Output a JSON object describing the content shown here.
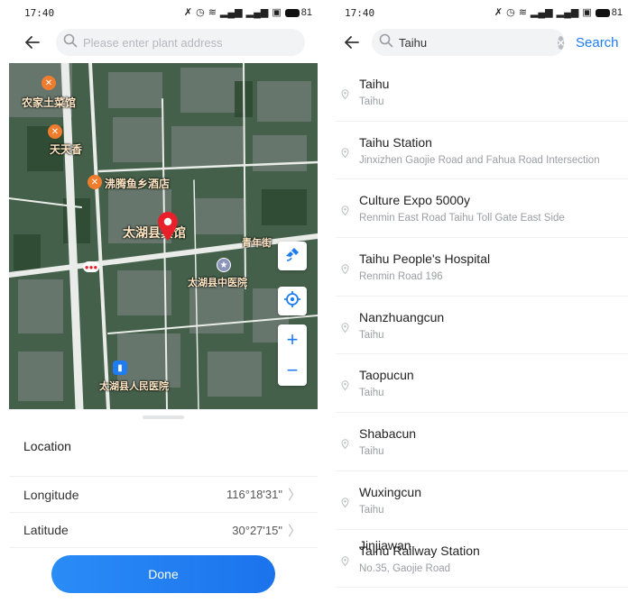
{
  "left": {
    "status": {
      "time": "17:40",
      "battery": "81"
    },
    "search": {
      "placeholder": "Please enter plant address",
      "value": ""
    },
    "map": {
      "labels": [
        "农家土菜馆",
        "天天香",
        "沸腾鱼乡酒店",
        "太湖县宾馆",
        "青年街",
        "太湖县中医院",
        "太湖县人民医院"
      ]
    },
    "sheet": {
      "title": "Location",
      "longitude_label": "Longitude",
      "longitude_value": "116°18'31\"",
      "latitude_label": "Latitude",
      "latitude_value": "30°27'15\"",
      "done_label": "Done"
    }
  },
  "right": {
    "status": {
      "time": "17:40",
      "battery": "81"
    },
    "search": {
      "value": "Taihu",
      "action_label": "Search"
    },
    "results": [
      {
        "name": "Taihu",
        "address": "Taihu"
      },
      {
        "name": "Taihu Station",
        "address": "Jinxizhen Gaojie Road and Fahua Road Intersection"
      },
      {
        "name": "Culture Expo 5000y",
        "address": "Renmin East Road Taihu Toll Gate East Side"
      },
      {
        "name": "Taihu People's Hospital",
        "address": "Renmin Road 196"
      },
      {
        "name": "Nanzhuangcun",
        "address": "Taihu"
      },
      {
        "name": "Taopucun",
        "address": "Taihu"
      },
      {
        "name": "Shabacun",
        "address": "Taihu"
      },
      {
        "name": "Wuxingcun",
        "address": "Taihu"
      },
      {
        "name": "Taihu Railway Station",
        "address": "No.35, Gaojie Road"
      }
    ],
    "partial_result_name": "Jinjiawan"
  },
  "colors": {
    "accent": "#1e7cf2",
    "pin": "#e8202a",
    "divider": "#eef0f2"
  }
}
